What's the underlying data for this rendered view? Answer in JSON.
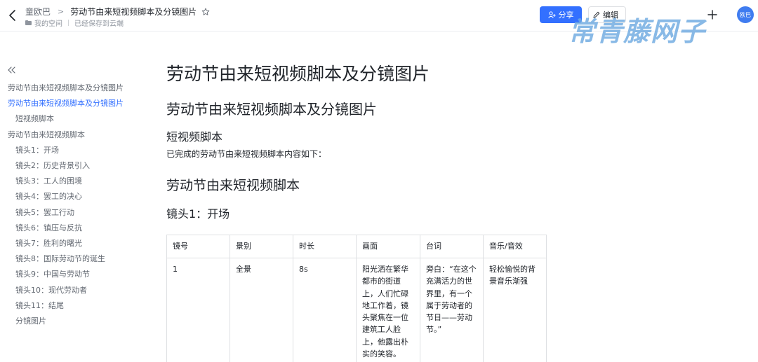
{
  "header": {
    "breadcrumb_space": "童欧巴",
    "breadcrumb_sep": ">",
    "doc_title": "劳动节由来短视频脚本及分镜图片",
    "location": "我的空间",
    "save_status": "已经保存到云端",
    "share_label": "分享",
    "edit_label": "编辑",
    "avatar_text": "欧巴"
  },
  "watermark": "常青藤网子",
  "toc": {
    "items": [
      {
        "label": "劳动节由来短视频脚本及分镜图片",
        "level": "h1"
      },
      {
        "label": "劳动节由来短视频脚本及分镜图片",
        "level": "active"
      },
      {
        "label": "短视频脚本",
        "level": "h3"
      },
      {
        "label": "劳动节由来短视频脚本",
        "level": "h2"
      },
      {
        "label": "镜头1：开场",
        "level": "h3"
      },
      {
        "label": "镜头2：历史背景引入",
        "level": "h3"
      },
      {
        "label": "镜头3：工人的困境",
        "level": "h3"
      },
      {
        "label": "镜头4：罢工的决心",
        "level": "h3"
      },
      {
        "label": "镜头5：罢工行动",
        "level": "h3"
      },
      {
        "label": "镜头6：镇压与反抗",
        "level": "h3"
      },
      {
        "label": "镜头7：胜利的曙光",
        "level": "h3"
      },
      {
        "label": "镜头8：国际劳动节的诞生",
        "level": "h3"
      },
      {
        "label": "镜头9：中国与劳动节",
        "level": "h3"
      },
      {
        "label": "镜头10：现代劳动者",
        "level": "h3"
      },
      {
        "label": "镜头11：结尾",
        "level": "h3"
      },
      {
        "label": "分镜图片",
        "level": "h3"
      }
    ]
  },
  "doc": {
    "title": "劳动节由来短视频脚本及分镜图片",
    "heading1": "劳动节由来短视频脚本及分镜图片",
    "heading2": "短视频脚本",
    "intro": "已完成的劳动节由来短视频脚本内容如下：",
    "heading3": "劳动节由来短视频脚本",
    "heading4": "镜头1：开场"
  },
  "table": {
    "headers": [
      "镜号",
      "景别",
      "时长",
      "画面",
      "台词",
      "音乐/音效"
    ],
    "rows": [
      [
        "1",
        "全景",
        "8s",
        "阳光洒在繁华都市的街道上，人们忙碌地工作着，镜头聚焦在一位建筑工人脸上，他露出朴实的笑容。",
        "旁白：“在这个充满活力的世界里，有一个属于劳动者的节日——劳动节。”",
        "轻松愉悦的背景音乐渐强"
      ]
    ]
  },
  "colors": {
    "accent": "#3370ff",
    "watermark": "#6eaae1"
  }
}
